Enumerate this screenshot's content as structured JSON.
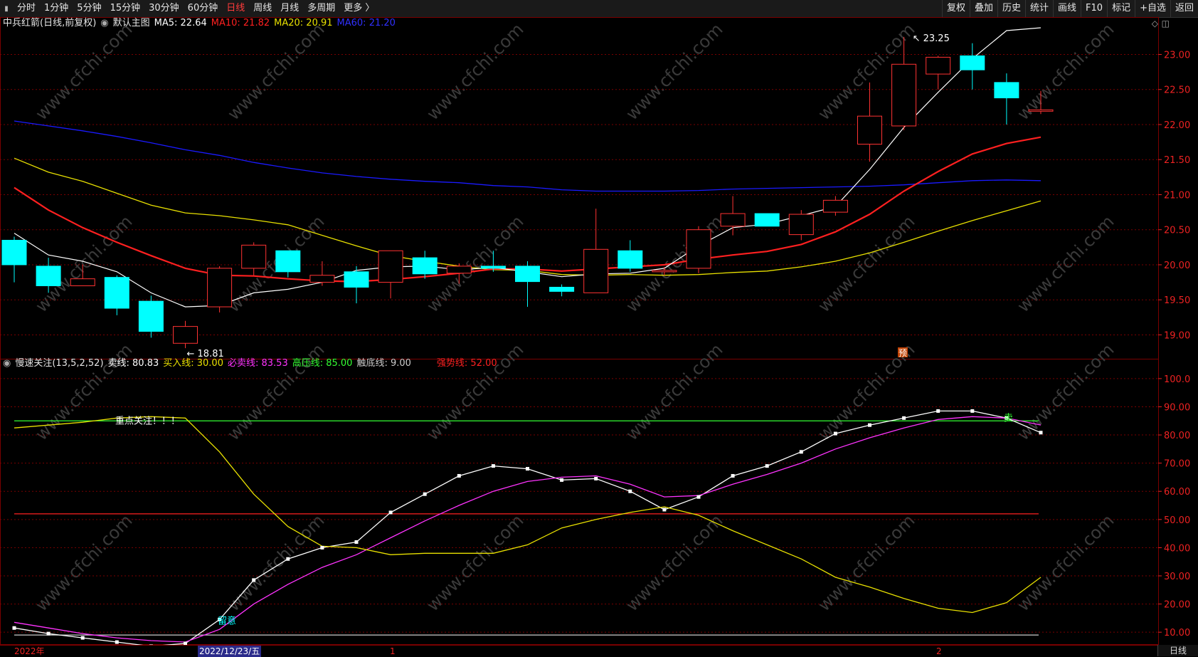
{
  "toolbar": {
    "left_items": [
      "分时",
      "1分钟",
      "5分钟",
      "15分钟",
      "30分钟",
      "60分钟",
      "日线",
      "周线",
      "月线",
      "多周期",
      "更多 〉"
    ],
    "active": "日线",
    "right_items": [
      "复权",
      "叠加",
      "历史",
      "统计",
      "画线",
      "F10",
      "标记",
      "+自选",
      "返回"
    ]
  },
  "main_legend": {
    "stock": "中兵红箭(日线,前复权)",
    "chart_name": "默认主图",
    "ma5": "MA5: 22.64",
    "ma10": "MA10: 21.82",
    "ma20": "MA20: 20.91",
    "ma60": "MA60: 21.20"
  },
  "main_axis_labels": [
    "23.00",
    "22.50",
    "22.00",
    "21.50",
    "21.00",
    "20.50",
    "20.00",
    "19.50",
    "19.00"
  ],
  "main_annotations": {
    "high": "23.25",
    "low": "18.81",
    "marker": "预"
  },
  "sub_legend": {
    "indicator": "慢速关注(13,5,2,52)",
    "sell": "卖线: 80.83",
    "buy": "买入线: 30.00",
    "must_sell": "必卖线: 83.53",
    "high_pressure": "高压线: 85.00",
    "bottom": "触底线: 9.00",
    "strong": "强势线: 52.00"
  },
  "sub_axis_labels": [
    "100.0",
    "90.00",
    "80.00",
    "70.00",
    "60.00",
    "50.00",
    "40.00",
    "30.00",
    "20.00",
    "10.00"
  ],
  "sub_annotations": {
    "focus": "重点关注！！！",
    "notice": "留意",
    "sell_mark": "卖"
  },
  "date_axis": {
    "left": "2022年",
    "selected": "2022/12/23/五",
    "m1": "1",
    "m2": "2"
  },
  "corner": "日线",
  "watermark": "www.cfchi.com",
  "colors": {
    "up": "#ff3333",
    "down": "#00ffff",
    "ma5": "#ffffff",
    "ma10": "#ff2020",
    "ma20": "#e8e000",
    "ma60": "#1a1aff",
    "grid": "#7a0000"
  },
  "chart_data": [
    {
      "type": "candlestick",
      "title": "中兵红箭(日线,前复权)",
      "ylim": [
        18.7,
        23.35
      ],
      "candles": [
        {
          "o": 20.35,
          "h": 20.4,
          "c": 20.0,
          "l": 19.75,
          "dir": "down"
        },
        {
          "o": 19.98,
          "h": 20.1,
          "c": 19.7,
          "l": 19.6,
          "dir": "down"
        },
        {
          "o": 19.7,
          "h": 20.0,
          "c": 19.8,
          "l": 19.7,
          "dir": "up"
        },
        {
          "o": 19.82,
          "h": 19.85,
          "c": 19.38,
          "l": 19.28,
          "dir": "down"
        },
        {
          "o": 19.48,
          "h": 19.56,
          "c": 19.05,
          "l": 18.96,
          "dir": "down"
        },
        {
          "o": 18.88,
          "h": 19.2,
          "c": 19.12,
          "l": 18.81,
          "dir": "up"
        },
        {
          "o": 19.4,
          "h": 19.98,
          "c": 19.95,
          "l": 19.32,
          "dir": "up"
        },
        {
          "o": 19.95,
          "h": 20.32,
          "c": 20.28,
          "l": 19.85,
          "dir": "up"
        },
        {
          "o": 20.2,
          "h": 20.2,
          "c": 19.9,
          "l": 19.82,
          "dir": "down"
        },
        {
          "o": 19.75,
          "h": 20.05,
          "c": 19.85,
          "l": 19.7,
          "dir": "up"
        },
        {
          "o": 19.9,
          "h": 19.98,
          "c": 19.68,
          "l": 19.45,
          "dir": "down"
        },
        {
          "o": 19.75,
          "h": 20.2,
          "c": 20.2,
          "l": 19.52,
          "dir": "up"
        },
        {
          "o": 20.1,
          "h": 20.2,
          "c": 19.87,
          "l": 19.8,
          "dir": "down"
        },
        {
          "o": 19.88,
          "h": 20.02,
          "c": 19.98,
          "l": 19.73,
          "dir": "up"
        },
        {
          "o": 19.98,
          "h": 20.2,
          "c": 19.95,
          "l": 19.9,
          "dir": "down"
        },
        {
          "o": 19.98,
          "h": 20.05,
          "c": 19.76,
          "l": 19.4,
          "dir": "down"
        },
        {
          "o": 19.68,
          "h": 19.72,
          "c": 19.62,
          "l": 19.55,
          "dir": "down"
        },
        {
          "o": 19.6,
          "h": 20.8,
          "c": 20.22,
          "l": 19.6,
          "dir": "up"
        },
        {
          "o": 20.2,
          "h": 20.35,
          "c": 19.95,
          "l": 19.9,
          "dir": "down"
        },
        {
          "o": 19.92,
          "h": 19.97,
          "c": 19.92,
          "l": 19.85,
          "dir": "up"
        },
        {
          "o": 19.95,
          "h": 20.55,
          "c": 20.5,
          "l": 19.88,
          "dir": "up"
        },
        {
          "o": 20.55,
          "h": 20.98,
          "c": 20.73,
          "l": 20.42,
          "dir": "up"
        },
        {
          "o": 20.73,
          "h": 20.73,
          "c": 20.55,
          "l": 20.55,
          "dir": "down"
        },
        {
          "o": 20.43,
          "h": 20.78,
          "c": 20.72,
          "l": 20.35,
          "dir": "up"
        },
        {
          "o": 20.75,
          "h": 20.98,
          "c": 20.92,
          "l": 20.7,
          "dir": "up"
        },
        {
          "o": 21.72,
          "h": 22.6,
          "c": 22.12,
          "l": 21.47,
          "dir": "up"
        },
        {
          "o": 21.98,
          "h": 23.25,
          "c": 22.86,
          "l": 21.92,
          "dir": "up"
        },
        {
          "o": 22.72,
          "h": 22.98,
          "c": 22.96,
          "l": 22.5,
          "dir": "up"
        },
        {
          "o": 22.98,
          "h": 23.16,
          "c": 22.78,
          "l": 22.5,
          "dir": "down"
        },
        {
          "o": 22.6,
          "h": 22.73,
          "c": 22.38,
          "l": 22.0,
          "dir": "down"
        },
        {
          "o": 22.21,
          "h": 22.48,
          "c": 22.21,
          "l": 22.15,
          "dir": "up"
        }
      ],
      "ma5": [
        20.45,
        20.14,
        20.05,
        19.9,
        19.6,
        19.4,
        19.42,
        19.6,
        19.65,
        19.75,
        19.92,
        19.97,
        19.98,
        19.93,
        19.96,
        19.9,
        19.83,
        19.87,
        19.88,
        19.95,
        20.27,
        20.53,
        20.58,
        20.7,
        20.83,
        21.36,
        21.96,
        22.46,
        22.94,
        23.34,
        23.38
      ],
      "ma10": [
        21.1,
        20.78,
        20.53,
        20.32,
        20.13,
        19.95,
        19.85,
        19.84,
        19.8,
        19.77,
        19.76,
        19.79,
        19.83,
        19.88,
        19.94,
        19.94,
        19.91,
        19.94,
        19.97,
        20.0,
        20.08,
        20.14,
        20.19,
        20.29,
        20.47,
        20.72,
        21.05,
        21.33,
        21.58,
        21.73,
        21.82
      ],
      "ma20": [
        21.52,
        21.32,
        21.19,
        21.02,
        20.85,
        20.74,
        20.7,
        20.64,
        20.57,
        20.42,
        20.27,
        20.13,
        20.05,
        19.98,
        19.93,
        19.92,
        19.86,
        19.85,
        19.86,
        19.85,
        19.86,
        19.89,
        19.91,
        19.97,
        20.05,
        20.17,
        20.32,
        20.48,
        20.63,
        20.77,
        20.91
      ],
      "ma60": [
        22.05,
        21.98,
        21.91,
        21.83,
        21.74,
        21.64,
        21.56,
        21.46,
        21.38,
        21.31,
        21.26,
        21.22,
        21.19,
        21.17,
        21.13,
        21.11,
        21.07,
        21.05,
        21.05,
        21.05,
        21.06,
        21.08,
        21.09,
        21.1,
        21.11,
        21.12,
        21.14,
        21.17,
        21.2,
        21.21,
        21.2
      ]
    },
    {
      "type": "line",
      "title": "慢速关注(13,5,2,52)",
      "ylim": [
        6.0,
        103.0
      ],
      "series": [
        {
          "name": "卖线",
          "values": [
            11.5,
            9.5,
            8.0,
            6.5,
            5.0,
            6.0,
            14.5,
            28.5,
            36.0,
            40.0,
            42.0,
            52.5,
            59.0,
            65.5,
            69.0,
            68.0,
            64.0,
            64.5,
            60.0,
            53.5,
            58.0,
            65.5,
            69.0,
            74.0,
            80.5,
            83.5,
            86.0,
            88.5,
            88.5,
            86.0,
            80.83
          ]
        },
        {
          "name": "必卖线",
          "values": [
            13.5,
            11.5,
            9.5,
            8.0,
            7.0,
            6.5,
            11.0,
            20.0,
            27.0,
            33.0,
            37.5,
            43.5,
            49.5,
            55.0,
            60.0,
            63.5,
            65.0,
            65.5,
            62.5,
            58.0,
            58.5,
            62.5,
            66.0,
            70.0,
            75.0,
            79.0,
            82.5,
            85.5,
            86.5,
            86.0,
            83.53
          ]
        },
        {
          "name": "买入线",
          "values": [
            82.5,
            83.5,
            84.5,
            86.0,
            86.5,
            86.0,
            74.0,
            59.0,
            47.5,
            40.5,
            40.0,
            37.5,
            38.0,
            38.0,
            38.0,
            41.0,
            47.0,
            50.0,
            52.5,
            54.5,
            51.5,
            46.0,
            41.0,
            36.0,
            29.5,
            26.0,
            22.0,
            18.5,
            17.0,
            20.5,
            29.5
          ]
        }
      ],
      "levels": {
        "高压线": 85.0,
        "强势线": 52.0,
        "触底线": 9.0
      }
    }
  ]
}
